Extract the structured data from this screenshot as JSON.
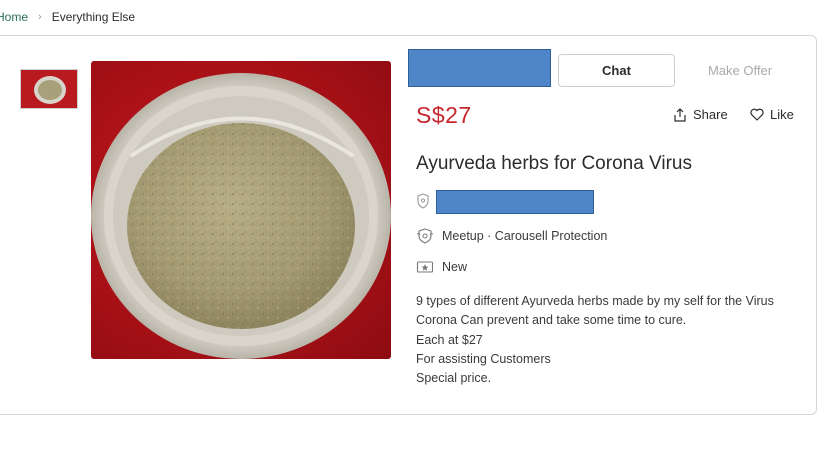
{
  "breadcrumb": {
    "home": "Home",
    "category": "Everything Else"
  },
  "listing": {
    "price": "S$27",
    "title": "Ayurveda herbs for Corona Virus",
    "meetup": "Meetup · Carousell Protection",
    "condition": "New",
    "description": [
      "9 types of different Ayurveda herbs made by my self for the Virus",
      "Corona Can prevent and take some time to cure.",
      "Each at $27",
      "For assisting Customers",
      "Special price."
    ]
  },
  "actions": {
    "chat_label": "Chat",
    "offer_label": "Make Offer",
    "share_label": "Share",
    "like_label": "Like"
  },
  "icons": {
    "breadcrumb_separator": "chevron-right-icon",
    "share": "share-icon",
    "like": "heart-icon",
    "seller": "seller-badge-icon",
    "meetup": "protection-badge-icon",
    "condition": "condition-tag-icon"
  },
  "colors": {
    "price": "#c8262c",
    "breadcrumb_home": "#2a6e5b",
    "redaction": "#4e86c8",
    "offer_disabled": "#a9a9a9"
  }
}
